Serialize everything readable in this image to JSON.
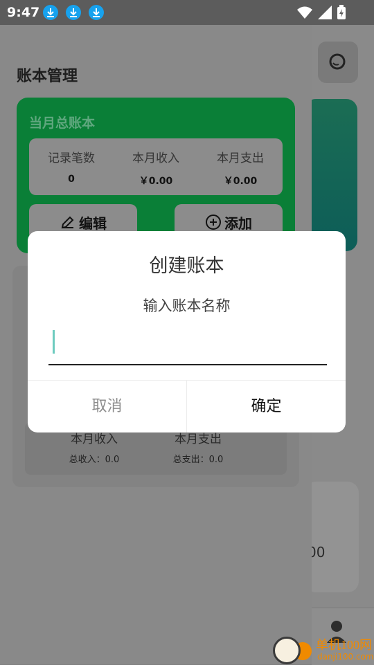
{
  "status_bar": {
    "time": "9:47"
  },
  "drawer": {
    "title": "账本管理",
    "summary_card": {
      "title": "当月总账本",
      "stats": [
        {
          "label": "记录笔数",
          "value": "0"
        },
        {
          "label": "本月收入",
          "value": "￥0.00"
        },
        {
          "label": "本月支出",
          "value": "￥0.00"
        }
      ],
      "edit_label": "编辑",
      "add_label": "添加"
    },
    "list_card": {
      "income_header": "本月收入",
      "expense_header": "本月支出",
      "income_total": "总收入：0.0",
      "expense_total": "总支出：0.0"
    }
  },
  "background": {
    "partial_amount": "00"
  },
  "dialog": {
    "title": "创建账本",
    "subtitle": "输入账本名称",
    "input_value": "",
    "cancel_label": "取消",
    "confirm_label": "确定"
  },
  "watermark": {
    "brand": "单机100网",
    "url": "danji100.com"
  },
  "colors": {
    "accent_green": "#0a7f37",
    "cursor_teal": "#6dcbbf",
    "download_blue": "#17a2ee",
    "watermark_orange": "#f08a00"
  }
}
